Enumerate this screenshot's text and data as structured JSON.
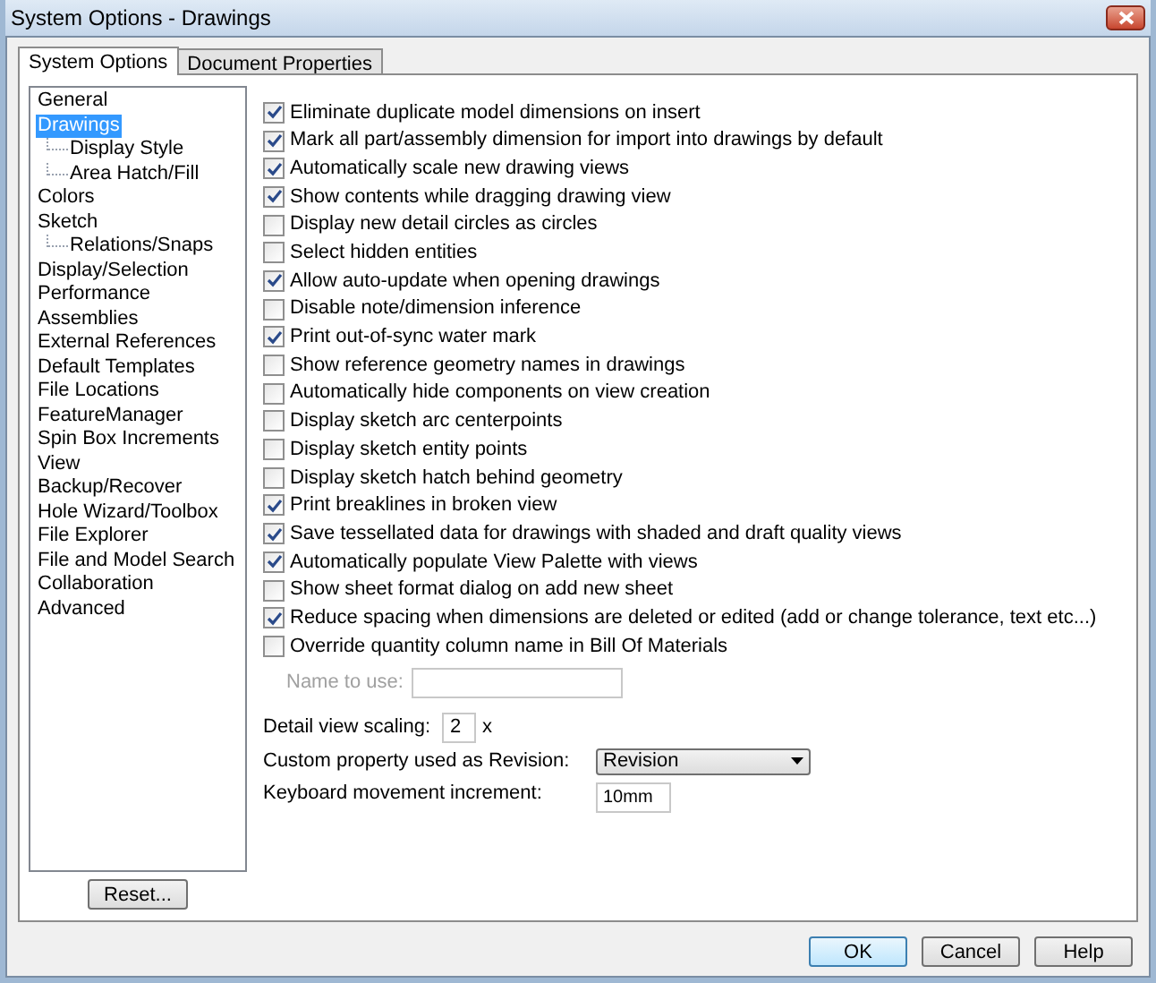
{
  "window": {
    "title": "System Options - Drawings"
  },
  "tabs": [
    {
      "label": "System Options",
      "selected": true
    },
    {
      "label": "Document Properties",
      "selected": false
    }
  ],
  "tree": [
    {
      "label": "General",
      "selected": false
    },
    {
      "label": "Drawings",
      "selected": true,
      "children": [
        {
          "label": "Display Style",
          "selected": false
        },
        {
          "label": "Area Hatch/Fill",
          "selected": false
        }
      ]
    },
    {
      "label": "Colors",
      "selected": false
    },
    {
      "label": "Sketch",
      "selected": false,
      "children": [
        {
          "label": "Relations/Snaps",
          "selected": false
        }
      ]
    },
    {
      "label": "Display/Selection",
      "selected": false
    },
    {
      "label": "Performance",
      "selected": false
    },
    {
      "label": "Assemblies",
      "selected": false
    },
    {
      "label": "External References",
      "selected": false
    },
    {
      "label": "Default Templates",
      "selected": false
    },
    {
      "label": "File Locations",
      "selected": false
    },
    {
      "label": "FeatureManager",
      "selected": false
    },
    {
      "label": "Spin Box Increments",
      "selected": false
    },
    {
      "label": "View",
      "selected": false
    },
    {
      "label": "Backup/Recover",
      "selected": false
    },
    {
      "label": "Hole Wizard/Toolbox",
      "selected": false
    },
    {
      "label": "File Explorer",
      "selected": false
    },
    {
      "label": "File and Model Search",
      "selected": false
    },
    {
      "label": "Collaboration",
      "selected": false
    },
    {
      "label": "Advanced",
      "selected": false
    }
  ],
  "reset_button": "Reset...",
  "options": [
    {
      "label": "Eliminate duplicate model dimensions on insert",
      "checked": true
    },
    {
      "label": "Mark all part/assembly dimension for import into drawings by default",
      "checked": true
    },
    {
      "label": "Automatically scale new drawing views",
      "checked": true
    },
    {
      "label": "Show contents while dragging drawing view",
      "checked": true
    },
    {
      "label": "Display new detail circles as circles",
      "checked": false
    },
    {
      "label": "Select hidden entities",
      "checked": false
    },
    {
      "label": "Allow auto-update when opening drawings",
      "checked": true
    },
    {
      "label": "Disable note/dimension inference",
      "checked": false
    },
    {
      "label": "Print out-of-sync water mark",
      "checked": true
    },
    {
      "label": "Show reference geometry names in drawings",
      "checked": false
    },
    {
      "label": "Automatically hide components on view creation",
      "checked": false
    },
    {
      "label": "Display sketch arc centerpoints",
      "checked": false
    },
    {
      "label": "Display sketch entity points",
      "checked": false
    },
    {
      "label": "Display sketch hatch behind geometry",
      "checked": false
    },
    {
      "label": "Print breaklines in broken view",
      "checked": true
    },
    {
      "label": "Save tessellated data for drawings with shaded and draft quality views",
      "checked": true
    },
    {
      "label": "Automatically populate View Palette with views",
      "checked": true
    },
    {
      "label": "Show sheet format dialog on add new sheet",
      "checked": false
    },
    {
      "label": "Reduce spacing when dimensions are deleted or edited (add or change tolerance, text etc...)",
      "checked": true
    },
    {
      "label": "Override quantity column name in Bill Of Materials",
      "checked": false
    }
  ],
  "name_to_use": {
    "label": "Name to use:",
    "disabled": true
  },
  "detail_view_scaling": {
    "label": "Detail view scaling:",
    "value": "2",
    "unit": "x"
  },
  "revision_property": {
    "label": "Custom property used as Revision:",
    "value": "Revision"
  },
  "keyboard_increment": {
    "label": "Keyboard movement increment:",
    "value": "10mm"
  },
  "buttons": [
    {
      "label": "OK",
      "kind": "default"
    },
    {
      "label": "Cancel",
      "kind": "normal"
    },
    {
      "label": "Help",
      "kind": "normal"
    }
  ]
}
